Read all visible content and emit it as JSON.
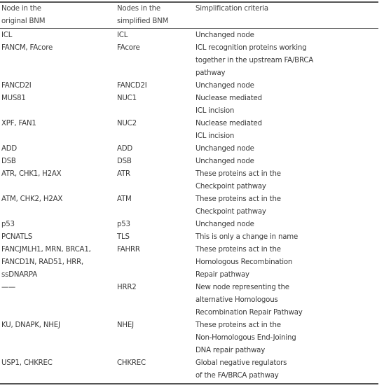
{
  "table": {
    "headers": [
      [
        "Node in the",
        "original BNM"
      ],
      [
        "Nodes in the",
        "simplified BNM"
      ],
      [
        "Simplification criteria"
      ]
    ],
    "rows": [
      {
        "original": [
          "ICL"
        ],
        "simplified": [
          "ICL"
        ],
        "criteria": [
          "Unchanged node"
        ]
      },
      {
        "original": [
          "FANCM, FAcore"
        ],
        "simplified": [
          "FAcore"
        ],
        "criteria": [
          "ICL recognition proteins working",
          "together in the upstream FA/BRCA",
          "pathway"
        ]
      },
      {
        "original": [
          "FANCD2I"
        ],
        "simplified": [
          "FANCD2I"
        ],
        "criteria": [
          "Unchanged node"
        ]
      },
      {
        "original": [
          "MUS81"
        ],
        "simplified": [
          "NUC1"
        ],
        "criteria": [
          "Nuclease mediated",
          "ICL incision"
        ]
      },
      {
        "original": [
          "XPF, FAN1"
        ],
        "simplified": [
          "NUC2"
        ],
        "criteria": [
          "Nuclease mediated",
          "ICL incision"
        ]
      },
      {
        "original": [
          "ADD"
        ],
        "simplified": [
          "ADD"
        ],
        "criteria": [
          "Unchanged node"
        ]
      },
      {
        "original": [
          "DSB"
        ],
        "simplified": [
          "DSB"
        ],
        "criteria": [
          "Unchanged node"
        ]
      },
      {
        "original": [
          "ATR, CHK1, H2AX"
        ],
        "simplified": [
          "ATR"
        ],
        "criteria": [
          "These proteins act in the",
          "Checkpoint pathway"
        ]
      },
      {
        "original": [
          "ATM, CHK2, H2AX"
        ],
        "simplified": [
          "ATM"
        ],
        "criteria": [
          "These proteins act in the",
          "Checkpoint pathway"
        ]
      },
      {
        "original": [
          "p53"
        ],
        "simplified": [
          "p53"
        ],
        "criteria": [
          "Unchanged node"
        ]
      },
      {
        "original": [
          "PCNATLS"
        ],
        "simplified": [
          "TLS"
        ],
        "criteria": [
          "This is only a change in name"
        ]
      },
      {
        "original": [
          "FANCJMLH1, MRN, BRCA1,",
          "FANCD1N, RAD51, HRR,",
          "ssDNARPA"
        ],
        "simplified": [
          "FAHRR"
        ],
        "criteria": [
          "These proteins act in the",
          "Homologous Recombination",
          "Repair pathway"
        ]
      },
      {
        "original": [
          "——"
        ],
        "simplified": [
          "HRR2"
        ],
        "criteria": [
          "New node representing the",
          "alternative Homologous",
          "Recombination Repair Pathway"
        ]
      },
      {
        "original": [
          "KU, DNAPK, NHEJ"
        ],
        "simplified": [
          "NHEJ"
        ],
        "criteria": [
          "These proteins act in the",
          "Non-Homologous End-Joining",
          "DNA repair pathway"
        ]
      },
      {
        "original": [
          "USP1, CHKREC"
        ],
        "simplified": [
          "CHKREC"
        ],
        "criteria": [
          "Global negative regulators",
          "of the FA/BRCA pathway"
        ]
      }
    ]
  }
}
